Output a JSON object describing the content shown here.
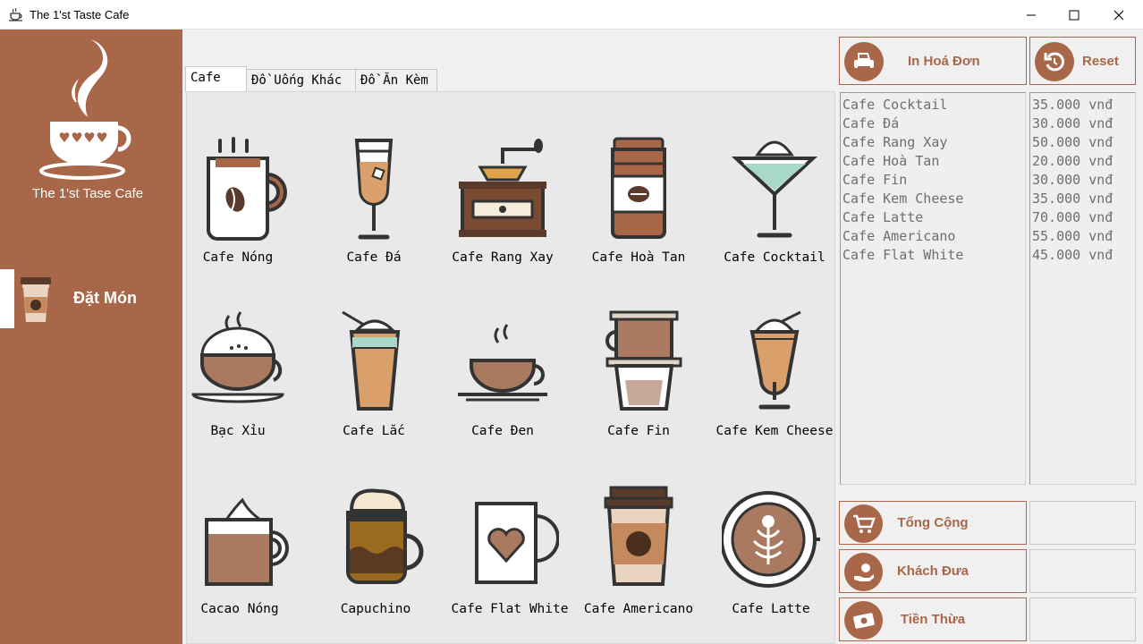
{
  "window": {
    "title": "The 1'st Taste Cafe"
  },
  "sidebar": {
    "logo_text": "The 1'st Tase Cafe",
    "nav_label": "Đặt Món"
  },
  "tabs": [
    {
      "label": "Cafe"
    },
    {
      "label": "Đồ Uống Khác"
    },
    {
      "label": "Đồ Ăn Kèm"
    }
  ],
  "menu": [
    {
      "label": "Cafe Nóng",
      "icon": "hot-coffee-mug-icon"
    },
    {
      "label": "Cafe Đá",
      "icon": "iced-coffee-glass-icon"
    },
    {
      "label": "Cafe Rang Xay",
      "icon": "coffee-grinder-icon"
    },
    {
      "label": "Cafe Hoà Tan",
      "icon": "instant-coffee-jar-icon"
    },
    {
      "label": "Cafe Cocktail",
      "icon": "coffee-cocktail-icon"
    },
    {
      "label": "Bạc Xỉu",
      "icon": "bac-xiu-cup-icon"
    },
    {
      "label": "Cafe Lắc",
      "icon": "shaken-coffee-icon"
    },
    {
      "label": "Cafe Đen",
      "icon": "black-coffee-cup-icon"
    },
    {
      "label": "Cafe Fin",
      "icon": "phin-filter-icon"
    },
    {
      "label": "Cafe Kem Cheese",
      "icon": "cheese-cream-coffee-icon"
    },
    {
      "label": "Cacao Nóng",
      "icon": "hot-cocoa-icon"
    },
    {
      "label": "Capuchino",
      "icon": "cappuccino-icon"
    },
    {
      "label": "Cafe Flat White",
      "icon": "flat-white-heart-mug-icon"
    },
    {
      "label": "Cafe Americano",
      "icon": "americano-cup-icon"
    },
    {
      "label": "Cafe Latte",
      "icon": "latte-art-icon"
    }
  ],
  "actions": {
    "print_label": "In Hoá Đơn",
    "reset_label": "Reset"
  },
  "order": {
    "items": [
      "Cafe Cocktail",
      "Cafe Đá",
      "Cafe Rang Xay",
      "Cafe Hoà Tan",
      "Cafe Fin",
      "Cafe Kem Cheese",
      "Cafe Latte",
      "Cafe Americano",
      "Cafe Flat White"
    ],
    "prices": [
      "35.000 vnđ",
      "30.000 vnđ",
      "50.000 vnđ",
      "20.000 vnđ",
      "30.000 vnđ",
      "35.000 vnđ",
      "70.000 vnđ",
      "55.000 vnđ",
      "45.000 vnđ"
    ]
  },
  "summary": {
    "total_label": "Tổng Cộng",
    "total_value": "",
    "paid_label": "Khách Đưa",
    "paid_value": "",
    "change_label": "Tiền Thừa",
    "change_value": ""
  },
  "colors": {
    "brand": "#a96749",
    "panel": "#e9e9e9",
    "background": "#f0f0f0"
  }
}
